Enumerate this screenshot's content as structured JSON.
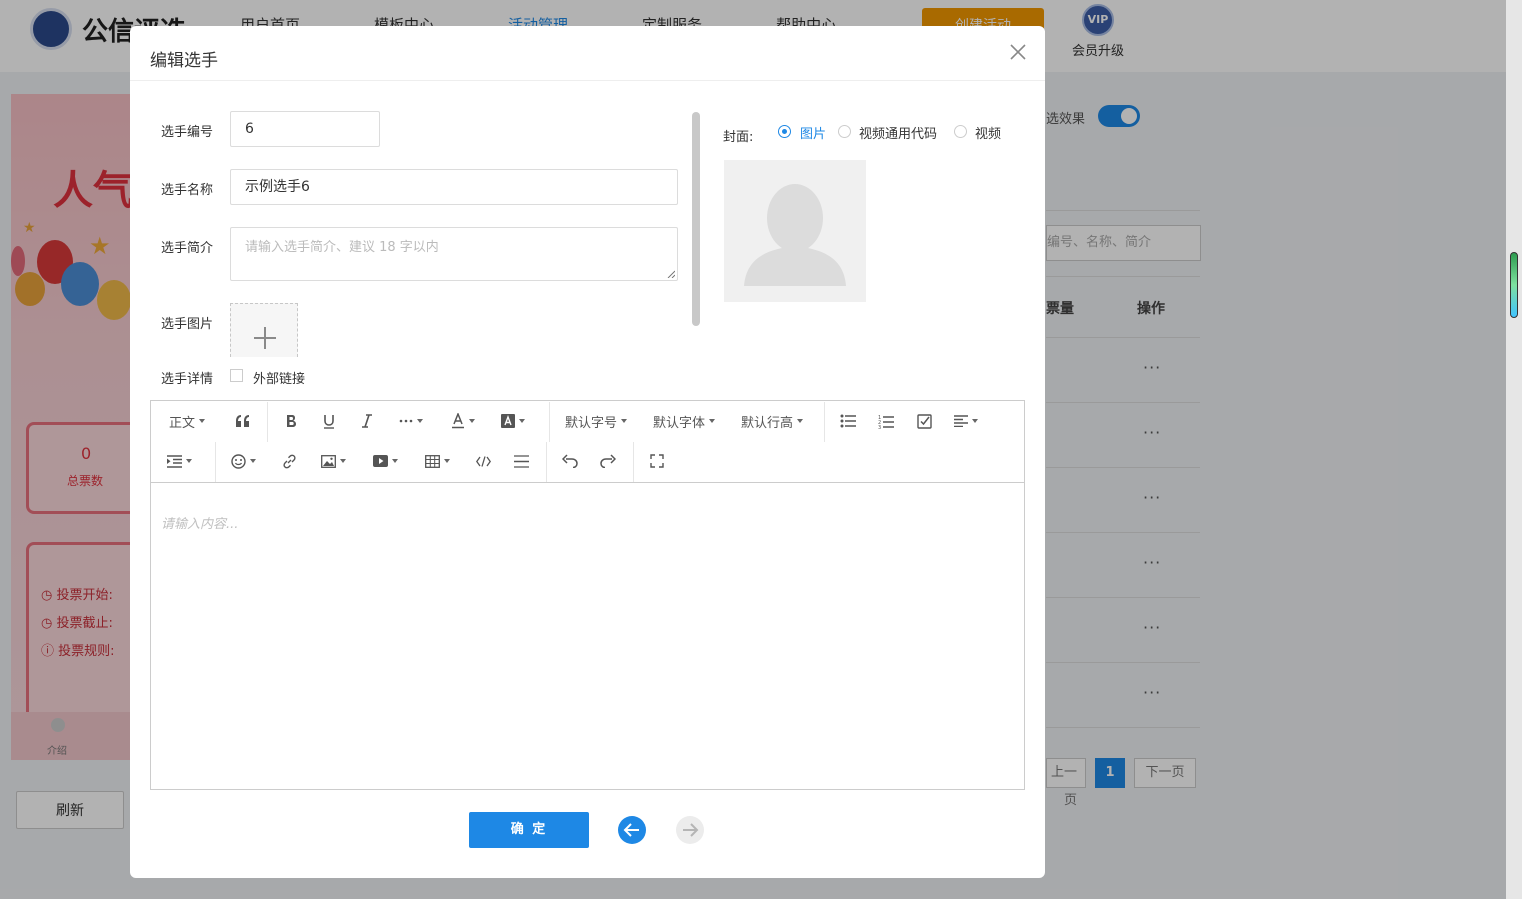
{
  "header": {
    "logo_text": "公信评选",
    "nav": [
      "用户首页",
      "模板中心",
      "活动管理",
      "定制服务",
      "帮助中心"
    ],
    "orange_button": "创建活动",
    "vip_label": "会员升级",
    "vip_badge": "VIP"
  },
  "preview": {
    "title": "人气",
    "total_votes_value": "0",
    "total_votes_label": "总票数",
    "info_rows": [
      "投票开始:",
      "投票截止:",
      "投票规则:"
    ],
    "intro_label": "介绍",
    "refresh_button": "刷新"
  },
  "right_panel": {
    "effect_label": "选效果",
    "search_placeholder": "编号、名称、简介",
    "col_count": "票量",
    "col_action": "操作",
    "row_action": "···",
    "pager_prev": "上一页",
    "pager_current": "1",
    "pager_next": "下一页"
  },
  "modal": {
    "title": "编辑选手",
    "fields": {
      "number_label": "选手编号",
      "number_value": "6",
      "name_label": "选手名称",
      "name_value": "示例选手6",
      "intro_label": "选手简介",
      "intro_placeholder": "请输入选手简介、建议 18 字以内",
      "image_label": "选手图片",
      "detail_label": "选手详情",
      "external_link_label": "外部链接"
    },
    "cover": {
      "label": "封面:",
      "options": [
        "图片",
        "视频通用代码",
        "视频"
      ],
      "selected": "图片"
    },
    "editor": {
      "paragraph": "正文",
      "font_size": "默认字号",
      "font_family": "默认字体",
      "line_height": "默认行高",
      "placeholder": "请输入内容..."
    },
    "confirm_button": "确 定"
  },
  "colors": {
    "accent": "#1e88e5",
    "orange": "#f39800",
    "preview_red": "#e0323e"
  }
}
